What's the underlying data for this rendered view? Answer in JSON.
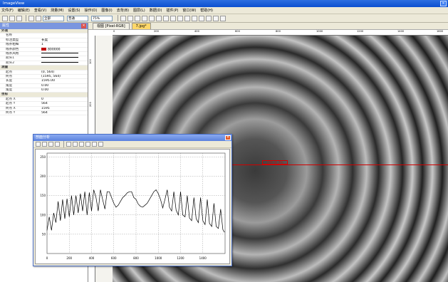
{
  "window": {
    "title": "ImageView",
    "close_glyph": "✕"
  },
  "menu": [
    "文件(F)",
    "编辑(E)",
    "查看(V)",
    "测量(M)",
    "设置(S)",
    "操作(O)",
    "图像(I)",
    "去背(B)",
    "图层(L)",
    "数据(D)",
    "插件(P)",
    "窗口(W)",
    "帮助(H)"
  ],
  "toolbar": {
    "combo1": "全部",
    "combo2": "普通",
    "zoom": "75%"
  },
  "properties": {
    "title": "属性",
    "close_glyph": "✕",
    "groups": [
      {
        "name": "外观",
        "rows": [
          {
            "k": "名称",
            "v": ""
          },
          {
            "k": "标注类型",
            "v": "长度"
          },
          {
            "k": "线条粗细",
            "v": "1"
          },
          {
            "k": "线条颜色",
            "v": "800000",
            "swatch": "#c00000"
          },
          {
            "k": "线条风格",
            "v": "",
            "line": true
          },
          {
            "k": "箭头1",
            "v": "",
            "line": true
          },
          {
            "k": "箭头2",
            "v": "",
            "line": true
          }
        ]
      },
      {
        "name": "测量",
        "rows": [
          {
            "k": "起点",
            "v": "(0, 564)"
          },
          {
            "k": "终点",
            "v": "(1595, 564)"
          },
          {
            "k": "长度",
            "v": "1595.00"
          },
          {
            "k": "角度",
            "v": "0.00"
          },
          {
            "k": "角度",
            "v": "0.00"
          }
        ]
      },
      {
        "name": "坐标",
        "rows": [
          {
            "k": "起点 X",
            "v": "0"
          },
          {
            "k": "起点 Y",
            "v": "564"
          },
          {
            "k": "终点 X",
            "v": "1595"
          },
          {
            "k": "终点 Y",
            "v": "564"
          }
        ]
      }
    ]
  },
  "tabs": [
    "视图 [Pixel-RGB]",
    "7.jpg*"
  ],
  "ruler": {
    "h": [
      "0",
      "200",
      "400",
      "600",
      "800",
      "1000",
      "1200",
      "1400",
      "1600"
    ],
    "v": [
      "100",
      "200"
    ]
  },
  "measurement_label": "1595.00 (Px)",
  "chart_window": {
    "title": "剖面分析",
    "close_glyph": "✕"
  },
  "chart_data": {
    "type": "line",
    "title": "",
    "xlabel": "",
    "ylabel": "",
    "xlim": [
      0,
      1600
    ],
    "ylim": [
      0,
      260
    ],
    "xticks": [
      0,
      200,
      400,
      600,
      800,
      1000,
      1200,
      1400
    ],
    "yticks": [
      50,
      100,
      150,
      200,
      250
    ],
    "grid": true,
    "series": [
      {
        "color": "#000000",
        "x": [
          0,
          20,
          40,
          60,
          80,
          100,
          120,
          140,
          160,
          180,
          200,
          220,
          240,
          260,
          280,
          300,
          320,
          340,
          360,
          380,
          400,
          420,
          440,
          460,
          480,
          500,
          520,
          540,
          560,
          580,
          600,
          620,
          640,
          660,
          680,
          700,
          720,
          740,
          760,
          780,
          800,
          820,
          840,
          860,
          880,
          900,
          920,
          940,
          960,
          980,
          1000,
          1020,
          1040,
          1060,
          1080,
          1100,
          1120,
          1140,
          1160,
          1180,
          1200,
          1220,
          1240,
          1260,
          1280,
          1300,
          1320,
          1340,
          1360,
          1380,
          1400,
          1420,
          1440,
          1460,
          1480,
          1500,
          1520,
          1540,
          1560,
          1580,
          1595
        ],
        "y": [
          60,
          95,
          60,
          105,
          80,
          135,
          85,
          140,
          90,
          142,
          95,
          150,
          100,
          150,
          105,
          155,
          110,
          160,
          100,
          158,
          110,
          165,
          145,
          110,
          165,
          140,
          115,
          160,
          160,
          145,
          130,
          120,
          125,
          135,
          145,
          150,
          157,
          160,
          160,
          145,
          140,
          128,
          122,
          120,
          125,
          130,
          140,
          150,
          160,
          165,
          155,
          140,
          118,
          140,
          165,
          120,
          110,
          160,
          112,
          100,
          160,
          100,
          95,
          150,
          92,
          85,
          145,
          90,
          80,
          145,
          85,
          75,
          140,
          78,
          70,
          130,
          70,
          65,
          115,
          62,
          55
        ]
      }
    ]
  }
}
